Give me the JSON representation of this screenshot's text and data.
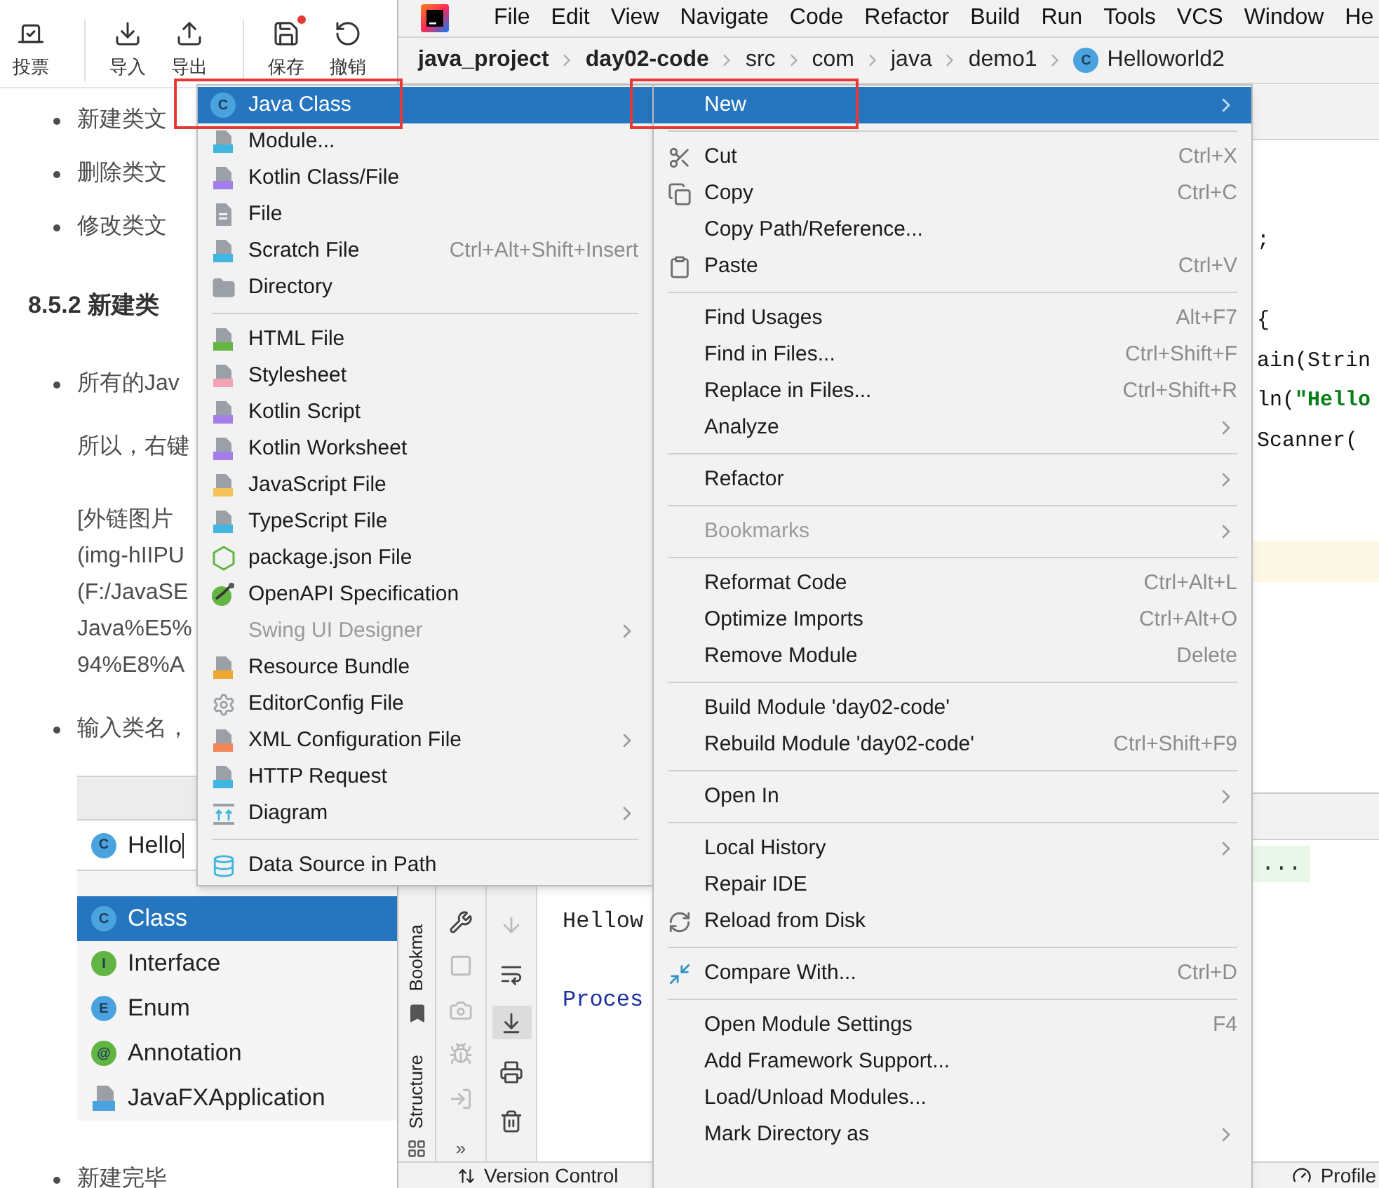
{
  "article": {
    "toolbar": [
      [
        {
          "label": "投票",
          "kind": "vote",
          "unsaved": false
        }
      ],
      [
        {
          "label": "导入",
          "kind": "import",
          "unsaved": false
        },
        {
          "label": "导出",
          "kind": "export",
          "unsaved": false
        }
      ],
      [
        {
          "label": "保存",
          "kind": "save",
          "unsaved": true
        },
        {
          "label": "撤销",
          "kind": "undo",
          "unsaved": false
        }
      ]
    ],
    "blocks": [
      {
        "kind": "bullet",
        "text": "新建类文"
      },
      {
        "kind": "bullet",
        "text": "删除类文"
      },
      {
        "kind": "bullet",
        "text": "修改类文"
      },
      {
        "kind": "heading",
        "text": "8.5.2 新建类"
      },
      {
        "kind": "bullet",
        "text": "所有的Jav"
      },
      {
        "kind": "para",
        "lines": [
          "所以，右键"
        ]
      },
      {
        "kind": "para",
        "lines": [
          "[外链图片",
          "(img-hIIPU",
          "(F:/JavaSE",
          "Java%E5%",
          "94%E8%A"
        ]
      },
      {
        "kind": "bullet",
        "text": "输入类名，"
      },
      {
        "kind": "dialog",
        "field": {
          "badge": "C",
          "value": "Hello"
        },
        "options": [
          {
            "kind": "badge",
            "badge": "C",
            "color": "#4aa3df",
            "label": "Class",
            "selected": true
          },
          {
            "kind": "badge",
            "badge": "I",
            "color": "#62b543",
            "label": "Interface",
            "selected": false
          },
          {
            "kind": "badge",
            "badge": "E",
            "color": "#4aa3df",
            "label": "Enum",
            "selected": false
          },
          {
            "kind": "badge",
            "badge": "@",
            "color": "#62b543",
            "label": "Annotation",
            "selected": false
          },
          {
            "kind": "file",
            "color": "#4aa3df",
            "label": "JavaFXApplication",
            "selected": false
          }
        ]
      },
      {
        "kind": "bullet",
        "text": "新建完毕"
      }
    ]
  },
  "ide": {
    "menu_bar": [
      "File",
      "Edit",
      "View",
      "Navigate",
      "Code",
      "Refactor",
      "Build",
      "Run",
      "Tools",
      "VCS",
      "Window",
      "He"
    ],
    "breadcrumbs": [
      {
        "label": "java_project",
        "bold": true
      },
      {
        "label": "day02-code",
        "bold": true
      },
      {
        "label": "src",
        "bold": false
      },
      {
        "label": "com",
        "bold": false
      },
      {
        "label": "java",
        "bold": false
      },
      {
        "label": "demo1",
        "bold": false
      },
      {
        "label": "Helloworld2",
        "bold": false,
        "badge": "C"
      }
    ],
    "code_lines": [
      {
        "kind": "code",
        "segments": [
          {
            "text": ";",
            "kind": "plain"
          }
        ]
      },
      {
        "kind": "blank"
      },
      {
        "kind": "code",
        "segments": [
          {
            "text": "{",
            "kind": "plain"
          }
        ]
      },
      {
        "kind": "code",
        "segments": [
          {
            "text": "ain(Strin",
            "kind": "plain"
          }
        ]
      },
      {
        "kind": "code",
        "segments": [
          {
            "text": "ln(",
            "kind": "plain"
          },
          {
            "text": "\"Hello",
            "kind": "string"
          }
        ]
      },
      {
        "kind": "code",
        "segments": [
          {
            "text": "Scanner(",
            "kind": "plain"
          }
        ]
      },
      {
        "kind": "blank"
      },
      {
        "kind": "blank"
      },
      {
        "kind": "current"
      }
    ],
    "run": {
      "side_tabs": [
        {
          "label": "Bookma",
          "kind": "bookmark"
        },
        {
          "label": "Structure",
          "kind": "structure"
        }
      ],
      "tools": [
        [
          {
            "kind": "wrench",
            "disabled": false,
            "selected": false
          },
          {
            "kind": "stop",
            "disabled": true,
            "selected": false
          },
          {
            "kind": "camera",
            "disabled": true,
            "selected": false
          },
          {
            "kind": "bug",
            "disabled": true,
            "selected": false
          },
          {
            "kind": "exit",
            "disabled": true,
            "selected": false
          }
        ],
        [
          {
            "kind": "down",
            "disabled": true,
            "selected": false
          },
          {
            "kind": "wrap",
            "disabled": false,
            "selected": false
          },
          {
            "kind": "scroll-end",
            "disabled": false,
            "selected": true
          },
          {
            "kind": "print",
            "disabled": false,
            "selected": false
          },
          {
            "kind": "trash",
            "disabled": false,
            "selected": false
          }
        ]
      ],
      "more": "»",
      "fold": "...",
      "output": [
        {
          "kind": "plain",
          "text": "Hellow"
        },
        {
          "kind": "blank"
        },
        {
          "kind": "info",
          "text": "Proces"
        }
      ]
    },
    "status_bar": [
      {
        "label": "Version Control",
        "kind": "vcs"
      },
      {
        "label": "Profile",
        "kind": "gauge"
      }
    ]
  },
  "new_menu": [
    [
      {
        "label": "Java Class",
        "badge": "C",
        "selected": true,
        "disabled": false,
        "submenu": false,
        "annotated": true
      },
      {
        "label": "Module...",
        "kind": "module",
        "selected": false,
        "disabled": false,
        "submenu": false,
        "annotated": false
      },
      {
        "label": "Kotlin Class/File",
        "kind": "kotlin",
        "selected": false,
        "disabled": false,
        "submenu": false,
        "annotated": false
      },
      {
        "label": "File",
        "kind": "file",
        "selected": false,
        "disabled": false,
        "submenu": false,
        "annotated": false
      },
      {
        "label": "Scratch File",
        "kind": "scratch",
        "shortcut": "Ctrl+Alt+Shift+Insert",
        "selected": false,
        "disabled": false,
        "submenu": false,
        "annotated": false
      },
      {
        "label": "Directory",
        "kind": "folder",
        "selected": false,
        "disabled": false,
        "submenu": false,
        "annotated": false
      }
    ],
    [
      {
        "label": "HTML File",
        "kind": "html",
        "selected": false,
        "disabled": false,
        "submenu": false,
        "annotated": false
      },
      {
        "label": "Stylesheet",
        "kind": "css",
        "selected": false,
        "disabled": false,
        "submenu": false,
        "annotated": false
      },
      {
        "label": "Kotlin Script",
        "kind": "kotlin",
        "selected": false,
        "disabled": false,
        "submenu": false,
        "annotated": false
      },
      {
        "label": "Kotlin Worksheet",
        "kind": "kotlin",
        "selected": false,
        "disabled": false,
        "submenu": false,
        "annotated": false
      },
      {
        "label": "JavaScript File",
        "kind": "js",
        "selected": false,
        "disabled": false,
        "submenu": false,
        "annotated": false
      },
      {
        "label": "TypeScript File",
        "kind": "ts",
        "selected": false,
        "disabled": false,
        "submenu": false,
        "annotated": false
      },
      {
        "label": "package.json File",
        "kind": "node",
        "selected": false,
        "disabled": false,
        "submenu": false,
        "annotated": false
      },
      {
        "label": "OpenAPI Specification",
        "kind": "openapi",
        "selected": false,
        "disabled": false,
        "submenu": false,
        "annotated": false
      },
      {
        "label": "Swing UI Designer",
        "selected": false,
        "disabled": true,
        "submenu": true,
        "annotated": false
      },
      {
        "label": "Resource Bundle",
        "kind": "bundle",
        "selected": false,
        "disabled": false,
        "submenu": false,
        "annotated": false
      },
      {
        "label": "EditorConfig File",
        "kind": "gear",
        "selected": false,
        "disabled": false,
        "submenu": false,
        "annotated": false
      },
      {
        "label": "XML Configuration File",
        "kind": "xml",
        "selected": false,
        "disabled": false,
        "submenu": true,
        "annotated": false
      },
      {
        "label": "HTTP Request",
        "kind": "api",
        "selected": false,
        "disabled": false,
        "submenu": false,
        "annotated": false
      },
      {
        "label": "Diagram",
        "kind": "diagram",
        "selected": false,
        "disabled": false,
        "submenu": true,
        "annotated": false
      }
    ],
    [
      {
        "label": "Data Source in Path",
        "kind": "database",
        "selected": false,
        "disabled": false,
        "submenu": false,
        "annotated": false
      }
    ]
  ],
  "context_menu": [
    [
      {
        "label": "New",
        "selected": true,
        "disabled": false,
        "submenu": true,
        "annotated": true
      }
    ],
    [
      {
        "label": "Cut",
        "kind": "cut",
        "shortcut": "Ctrl+X",
        "selected": false,
        "disabled": false,
        "submenu": false,
        "annotated": false
      },
      {
        "label": "Copy",
        "kind": "copy",
        "shortcut": "Ctrl+C",
        "selected": false,
        "disabled": false,
        "submenu": false,
        "annotated": false
      },
      {
        "label": "Copy Path/Reference...",
        "selected": false,
        "disabled": false,
        "submenu": false,
        "annotated": false
      },
      {
        "label": "Paste",
        "kind": "paste",
        "shortcut": "Ctrl+V",
        "selected": false,
        "disabled": false,
        "submenu": false,
        "annotated": false
      }
    ],
    [
      {
        "label": "Find Usages",
        "shortcut": "Alt+F7",
        "selected": false,
        "disabled": false,
        "submenu": false,
        "annotated": false
      },
      {
        "label": "Find in Files...",
        "shortcut": "Ctrl+Shift+F",
        "selected": false,
        "disabled": false,
        "submenu": false,
        "annotated": false
      },
      {
        "label": "Replace in Files...",
        "shortcut": "Ctrl+Shift+R",
        "selected": false,
        "disabled": false,
        "submenu": false,
        "annotated": false
      },
      {
        "label": "Analyze",
        "selected": false,
        "disabled": false,
        "submenu": true,
        "annotated": false
      }
    ],
    [
      {
        "label": "Refactor",
        "selected": false,
        "disabled": false,
        "submenu": true,
        "annotated": false
      }
    ],
    [
      {
        "label": "Bookmarks",
        "selected": false,
        "disabled": true,
        "submenu": true,
        "annotated": false
      }
    ],
    [
      {
        "label": "Reformat Code",
        "shortcut": "Ctrl+Alt+L",
        "selected": false,
        "disabled": false,
        "submenu": false,
        "annotated": false
      },
      {
        "label": "Optimize Imports",
        "shortcut": "Ctrl+Alt+O",
        "selected": false,
        "disabled": false,
        "submenu": false,
        "annotated": false
      },
      {
        "label": "Remove Module",
        "shortcut": "Delete",
        "selected": false,
        "disabled": false,
        "submenu": false,
        "annotated": false
      }
    ],
    [
      {
        "label": "Build Module 'day02-code'",
        "selected": false,
        "disabled": false,
        "submenu": false,
        "annotated": false
      },
      {
        "label": "Rebuild Module 'day02-code'",
        "shortcut": "Ctrl+Shift+F9",
        "selected": false,
        "disabled": false,
        "submenu": false,
        "annotated": false
      }
    ],
    [
      {
        "label": "Open In",
        "selected": false,
        "disabled": false,
        "submenu": true,
        "annotated": false
      }
    ],
    [
      {
        "label": "Local History",
        "selected": false,
        "disabled": false,
        "submenu": true,
        "annotated": false
      },
      {
        "label": "Repair IDE",
        "selected": false,
        "disabled": false,
        "submenu": false,
        "annotated": false
      },
      {
        "label": "Reload from Disk",
        "kind": "reload",
        "selected": false,
        "disabled": false,
        "submenu": false,
        "annotated": false
      }
    ],
    [
      {
        "label": "Compare With...",
        "kind": "compare",
        "shortcut": "Ctrl+D",
        "selected": false,
        "disabled": false,
        "submenu": false,
        "annotated": false
      }
    ],
    [
      {
        "label": "Open Module Settings",
        "shortcut": "F4",
        "selected": false,
        "disabled": false,
        "submenu": false,
        "annotated": false
      },
      {
        "label": "Add Framework Support...",
        "selected": false,
        "disabled": false,
        "submenu": false,
        "annotated": false
      },
      {
        "label": "Load/Unload Modules...",
        "selected": false,
        "disabled": false,
        "submenu": false,
        "annotated": false
      },
      {
        "label": "Mark Directory as",
        "selected": false,
        "disabled": false,
        "submenu": true,
        "annotated": false
      }
    ]
  ]
}
